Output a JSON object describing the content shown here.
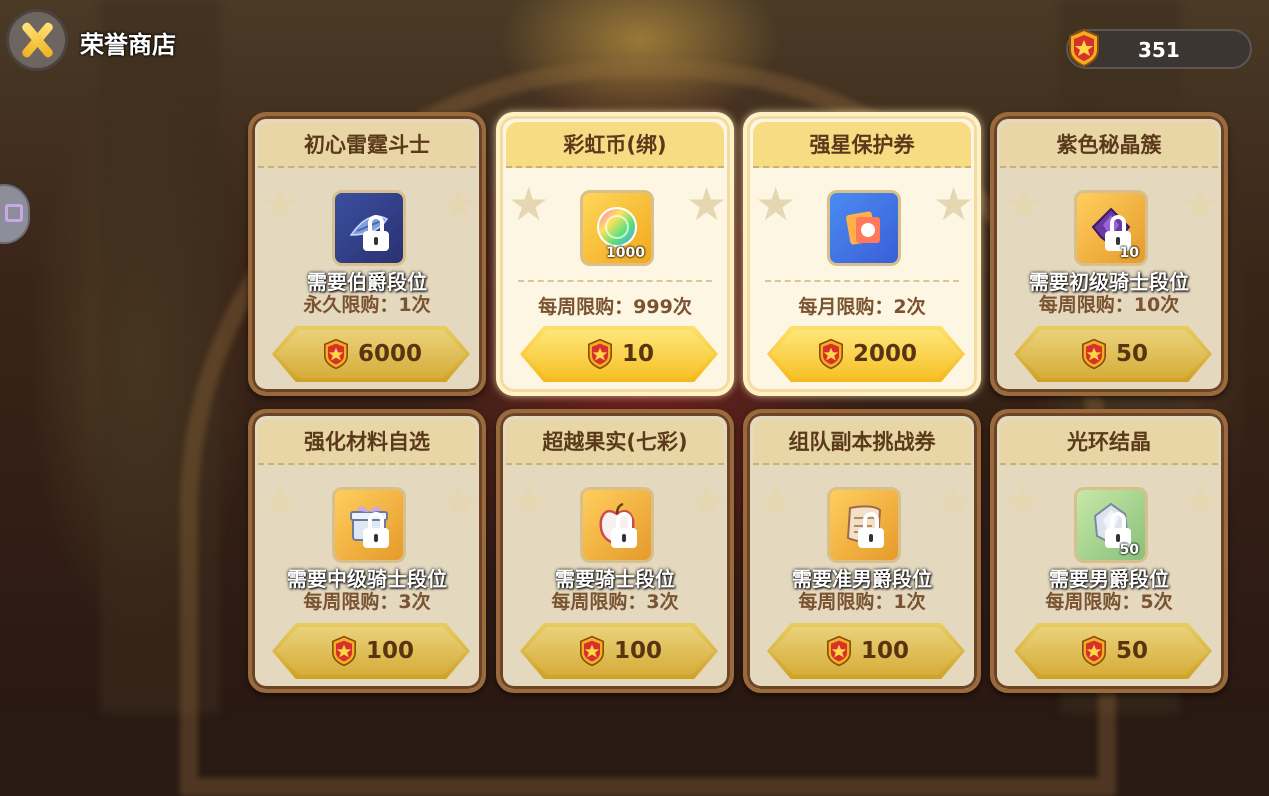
{
  "header": {
    "title": "荣誉商店",
    "currency_value": "351"
  },
  "cards": [
    {
      "name": "初心雷霆斗士",
      "requirement": "需要伯爵段位",
      "limit": "永久限购：1次",
      "price": "6000",
      "qty": "",
      "icon": "armor-icon",
      "locked": true
    },
    {
      "name": "彩虹币(绑)",
      "requirement": "",
      "limit": "每周限购：999次",
      "price": "10",
      "qty": "1000",
      "icon": "rainbow-coin-icon",
      "locked": false
    },
    {
      "name": "强星保护券",
      "requirement": "",
      "limit": "每月限购：2次",
      "price": "2000",
      "qty": "",
      "icon": "protection-ticket-icon",
      "locked": false
    },
    {
      "name": "紫色秘晶簇",
      "requirement": "需要初级骑士段位",
      "limit": "每周限购：10次",
      "price": "50",
      "qty": "10",
      "icon": "purple-crystal-icon",
      "locked": true
    },
    {
      "name": "强化材料自选",
      "requirement": "需要中级骑士段位",
      "limit": "每周限购：3次",
      "price": "100",
      "qty": "",
      "icon": "gift-box-icon",
      "locked": true
    },
    {
      "name": "超越果实(七彩)",
      "requirement": "需要骑士段位",
      "limit": "每周限购：3次",
      "price": "100",
      "qty": "",
      "icon": "apple-icon",
      "locked": true
    },
    {
      "name": "组队副本挑战券",
      "requirement": "需要准男爵段位",
      "limit": "每周限购：1次",
      "price": "100",
      "qty": "",
      "icon": "scroll-icon",
      "locked": true
    },
    {
      "name": "光环结晶",
      "requirement": "需要男爵段位",
      "limit": "每周限购：5次",
      "price": "50",
      "qty": "50",
      "icon": "crystal-icon",
      "locked": true
    }
  ],
  "colors": {
    "gold": "#f4b91c",
    "card_bg": "#f1e6cf",
    "border": "#9a6a3c"
  }
}
